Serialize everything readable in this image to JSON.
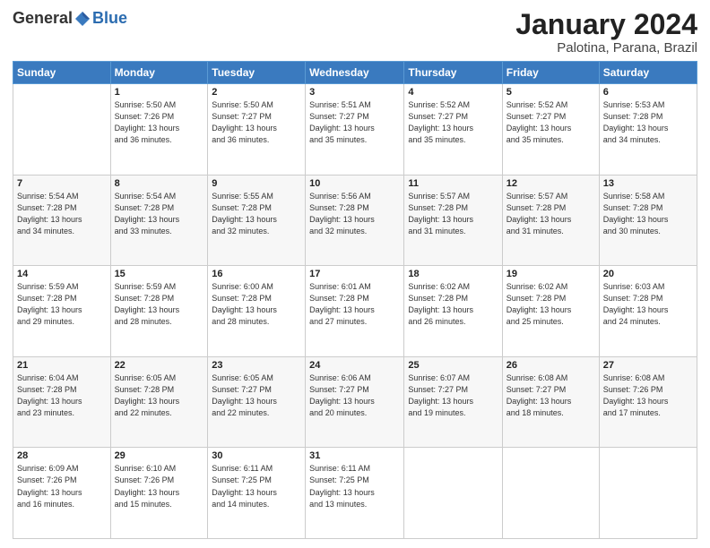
{
  "header": {
    "logo_general": "General",
    "logo_blue": "Blue",
    "month_title": "January 2024",
    "location": "Palotina, Parana, Brazil"
  },
  "days_of_week": [
    "Sunday",
    "Monday",
    "Tuesday",
    "Wednesday",
    "Thursday",
    "Friday",
    "Saturday"
  ],
  "weeks": [
    [
      {
        "day": "",
        "info": ""
      },
      {
        "day": "1",
        "info": "Sunrise: 5:50 AM\nSunset: 7:26 PM\nDaylight: 13 hours\nand 36 minutes."
      },
      {
        "day": "2",
        "info": "Sunrise: 5:50 AM\nSunset: 7:27 PM\nDaylight: 13 hours\nand 36 minutes."
      },
      {
        "day": "3",
        "info": "Sunrise: 5:51 AM\nSunset: 7:27 PM\nDaylight: 13 hours\nand 35 minutes."
      },
      {
        "day": "4",
        "info": "Sunrise: 5:52 AM\nSunset: 7:27 PM\nDaylight: 13 hours\nand 35 minutes."
      },
      {
        "day": "5",
        "info": "Sunrise: 5:52 AM\nSunset: 7:27 PM\nDaylight: 13 hours\nand 35 minutes."
      },
      {
        "day": "6",
        "info": "Sunrise: 5:53 AM\nSunset: 7:28 PM\nDaylight: 13 hours\nand 34 minutes."
      }
    ],
    [
      {
        "day": "7",
        "info": "Sunrise: 5:54 AM\nSunset: 7:28 PM\nDaylight: 13 hours\nand 34 minutes."
      },
      {
        "day": "8",
        "info": "Sunrise: 5:54 AM\nSunset: 7:28 PM\nDaylight: 13 hours\nand 33 minutes."
      },
      {
        "day": "9",
        "info": "Sunrise: 5:55 AM\nSunset: 7:28 PM\nDaylight: 13 hours\nand 32 minutes."
      },
      {
        "day": "10",
        "info": "Sunrise: 5:56 AM\nSunset: 7:28 PM\nDaylight: 13 hours\nand 32 minutes."
      },
      {
        "day": "11",
        "info": "Sunrise: 5:57 AM\nSunset: 7:28 PM\nDaylight: 13 hours\nand 31 minutes."
      },
      {
        "day": "12",
        "info": "Sunrise: 5:57 AM\nSunset: 7:28 PM\nDaylight: 13 hours\nand 31 minutes."
      },
      {
        "day": "13",
        "info": "Sunrise: 5:58 AM\nSunset: 7:28 PM\nDaylight: 13 hours\nand 30 minutes."
      }
    ],
    [
      {
        "day": "14",
        "info": "Sunrise: 5:59 AM\nSunset: 7:28 PM\nDaylight: 13 hours\nand 29 minutes."
      },
      {
        "day": "15",
        "info": "Sunrise: 5:59 AM\nSunset: 7:28 PM\nDaylight: 13 hours\nand 28 minutes."
      },
      {
        "day": "16",
        "info": "Sunrise: 6:00 AM\nSunset: 7:28 PM\nDaylight: 13 hours\nand 28 minutes."
      },
      {
        "day": "17",
        "info": "Sunrise: 6:01 AM\nSunset: 7:28 PM\nDaylight: 13 hours\nand 27 minutes."
      },
      {
        "day": "18",
        "info": "Sunrise: 6:02 AM\nSunset: 7:28 PM\nDaylight: 13 hours\nand 26 minutes."
      },
      {
        "day": "19",
        "info": "Sunrise: 6:02 AM\nSunset: 7:28 PM\nDaylight: 13 hours\nand 25 minutes."
      },
      {
        "day": "20",
        "info": "Sunrise: 6:03 AM\nSunset: 7:28 PM\nDaylight: 13 hours\nand 24 minutes."
      }
    ],
    [
      {
        "day": "21",
        "info": "Sunrise: 6:04 AM\nSunset: 7:28 PM\nDaylight: 13 hours\nand 23 minutes."
      },
      {
        "day": "22",
        "info": "Sunrise: 6:05 AM\nSunset: 7:28 PM\nDaylight: 13 hours\nand 22 minutes."
      },
      {
        "day": "23",
        "info": "Sunrise: 6:05 AM\nSunset: 7:27 PM\nDaylight: 13 hours\nand 22 minutes."
      },
      {
        "day": "24",
        "info": "Sunrise: 6:06 AM\nSunset: 7:27 PM\nDaylight: 13 hours\nand 20 minutes."
      },
      {
        "day": "25",
        "info": "Sunrise: 6:07 AM\nSunset: 7:27 PM\nDaylight: 13 hours\nand 19 minutes."
      },
      {
        "day": "26",
        "info": "Sunrise: 6:08 AM\nSunset: 7:27 PM\nDaylight: 13 hours\nand 18 minutes."
      },
      {
        "day": "27",
        "info": "Sunrise: 6:08 AM\nSunset: 7:26 PM\nDaylight: 13 hours\nand 17 minutes."
      }
    ],
    [
      {
        "day": "28",
        "info": "Sunrise: 6:09 AM\nSunset: 7:26 PM\nDaylight: 13 hours\nand 16 minutes."
      },
      {
        "day": "29",
        "info": "Sunrise: 6:10 AM\nSunset: 7:26 PM\nDaylight: 13 hours\nand 15 minutes."
      },
      {
        "day": "30",
        "info": "Sunrise: 6:11 AM\nSunset: 7:25 PM\nDaylight: 13 hours\nand 14 minutes."
      },
      {
        "day": "31",
        "info": "Sunrise: 6:11 AM\nSunset: 7:25 PM\nDaylight: 13 hours\nand 13 minutes."
      },
      {
        "day": "",
        "info": ""
      },
      {
        "day": "",
        "info": ""
      },
      {
        "day": "",
        "info": ""
      }
    ]
  ]
}
